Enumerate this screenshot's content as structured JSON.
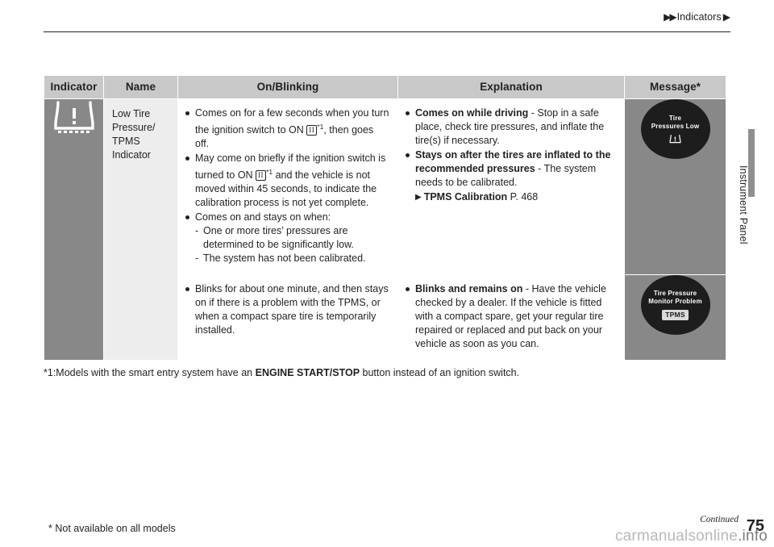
{
  "header": {
    "arrows": "▶▶",
    "title": "Indicators",
    "arrow_after": "▶"
  },
  "side_label": "Instrument Panel",
  "table": {
    "headers": [
      "Indicator",
      "Name",
      "On/Blinking",
      "Explanation",
      "Message*"
    ],
    "rows": [
      {
        "indicator_icon": "low-tire-pressure-icon",
        "name": "Low Tire Pressure/ TPMS Indicator",
        "on_blinking": [
          {
            "text_parts": [
              "Comes on for a few seconds when you turn the ignition switch to ON ",
              "(II)",
              "*1",
              ", then goes off."
            ]
          },
          {
            "text_parts": [
              "May come on briefly if the ignition switch is turned to ON ",
              "(II)",
              "*1",
              " and the vehicle is not moved within 45 seconds, to indicate the calibration process is not yet complete."
            ]
          },
          {
            "text": "Comes on and stays on when:",
            "sub": [
              "One or more tires’ pressures are determined to be significantly low.",
              "The system has not been calibrated."
            ]
          }
        ],
        "explanation": [
          {
            "bold": "Comes on while driving",
            "rest": " - Stop in a safe place, check tire pressures, and inflate the tire(s) if necessary."
          },
          {
            "bold": "Stays on after the tires are inflated to the recommended pressures",
            "rest": " - The system needs to be calibrated."
          }
        ],
        "reference": {
          "arrow": "▶",
          "label": "TPMS Calibration",
          "page": "P. 468"
        },
        "message": {
          "line1": "Tire",
          "line2": "Pressures Low",
          "icon": "tire-pressure-icon"
        }
      },
      {
        "on_blinking": [
          {
            "text": "Blinks for about one minute, and then stays on if there is a problem with the TPMS, or when a compact spare tire is temporarily installed."
          }
        ],
        "explanation": [
          {
            "bold": "Blinks and remains on",
            "rest": " - Have the vehicle checked by a dealer. If the vehicle is fitted with a compact spare, get your regular tire repaired or replaced and put back on your vehicle as soon as you can."
          }
        ],
        "message": {
          "line1": "Tire Pressure",
          "line2": "Monitor Problem",
          "badge": "TPMS"
        }
      }
    ]
  },
  "footnote": {
    "prefix": "*1:Models with the smart entry system have an ",
    "bold": "ENGINE START/STOP",
    "suffix": " button instead of an ignition switch."
  },
  "footer": {
    "note": "* Not available on all models",
    "continued": "Continued",
    "page_number": "75"
  },
  "watermark": {
    "light": "carmanualsonline",
    "dark": ".info"
  }
}
